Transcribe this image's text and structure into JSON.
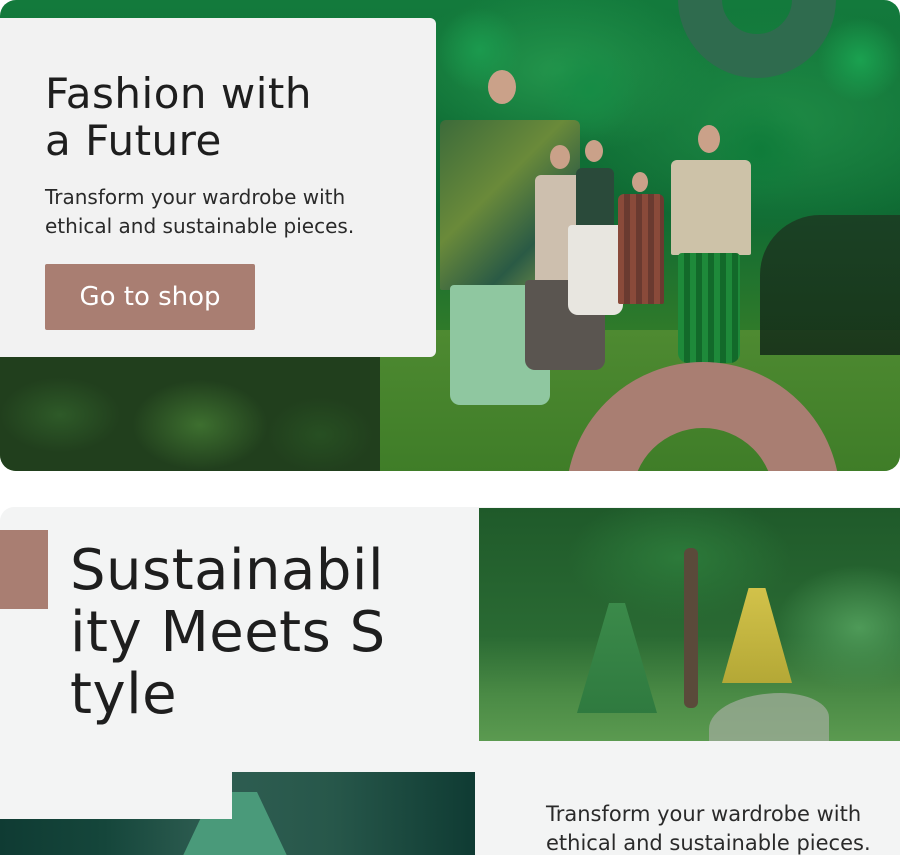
{
  "hero": {
    "title_line1": "Fashion with",
    "title_line2": "a Future",
    "subtitle_line1": "Transform your wardrobe with",
    "subtitle_line2": "ethical and sustainable pieces.",
    "cta_label": "Go to shop"
  },
  "section2": {
    "title": "Sustainability Meets Style",
    "subtitle_line1": "Transform your wardrobe with",
    "subtitle_line2": "ethical and sustainable pieces."
  },
  "colors": {
    "accent": "#a97e72",
    "ring": "#2f6b4e",
    "card_background": "#f2f2f2",
    "text": "#1e1e1e"
  }
}
